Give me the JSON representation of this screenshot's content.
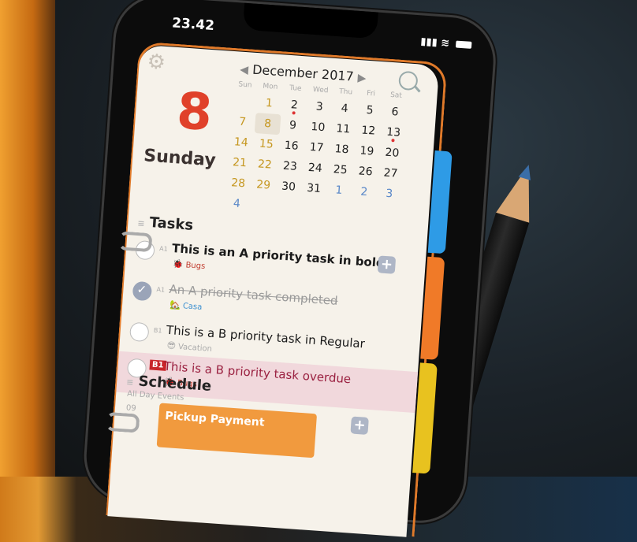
{
  "status": {
    "time": "23.42"
  },
  "calendar": {
    "month": "December 2017",
    "big_date": "8",
    "big_day": "Sunday",
    "weekdays": [
      "Sun",
      "Mon",
      "Tue",
      "Wed",
      "Thu",
      "Fri",
      "Sat"
    ],
    "weeks": [
      [
        "",
        "1",
        "2",
        "3",
        "4",
        "5",
        "6"
      ],
      [
        "7",
        "8",
        "9",
        "10",
        "11",
        "12",
        "13"
      ],
      [
        "14",
        "15",
        "16",
        "17",
        "18",
        "19",
        "20"
      ],
      [
        "21",
        "22",
        "23",
        "24",
        "25",
        "26",
        "27"
      ],
      [
        "28",
        "29",
        "30",
        "31",
        "1",
        "2",
        "3"
      ],
      [
        "4",
        "",
        "",
        "",
        "",
        "",
        ""
      ]
    ]
  },
  "tasks": {
    "title": "Tasks",
    "items": [
      {
        "pri": "A1",
        "title": "This is an A priority task in bold",
        "tag": "Bugs"
      },
      {
        "pri": "A1",
        "title": "An A priority task completed",
        "tag": "Casa"
      },
      {
        "pri": "B1",
        "title": "This is a B priority task in Regular",
        "tag": "Vacation"
      },
      {
        "pri": "B1",
        "title": "This is a B priority task overdue",
        "tag": "Bugs"
      }
    ]
  },
  "schedule": {
    "title": "Schedule",
    "all_day": "All Day Events",
    "hour": "09",
    "event": "Pickup Payment"
  },
  "colors": {
    "accent": "#e0412a",
    "weekend": "#c69822",
    "event": "#f19a3e",
    "tabs": [
      "#2e9be6",
      "#f07a28",
      "#e8c21f"
    ]
  }
}
